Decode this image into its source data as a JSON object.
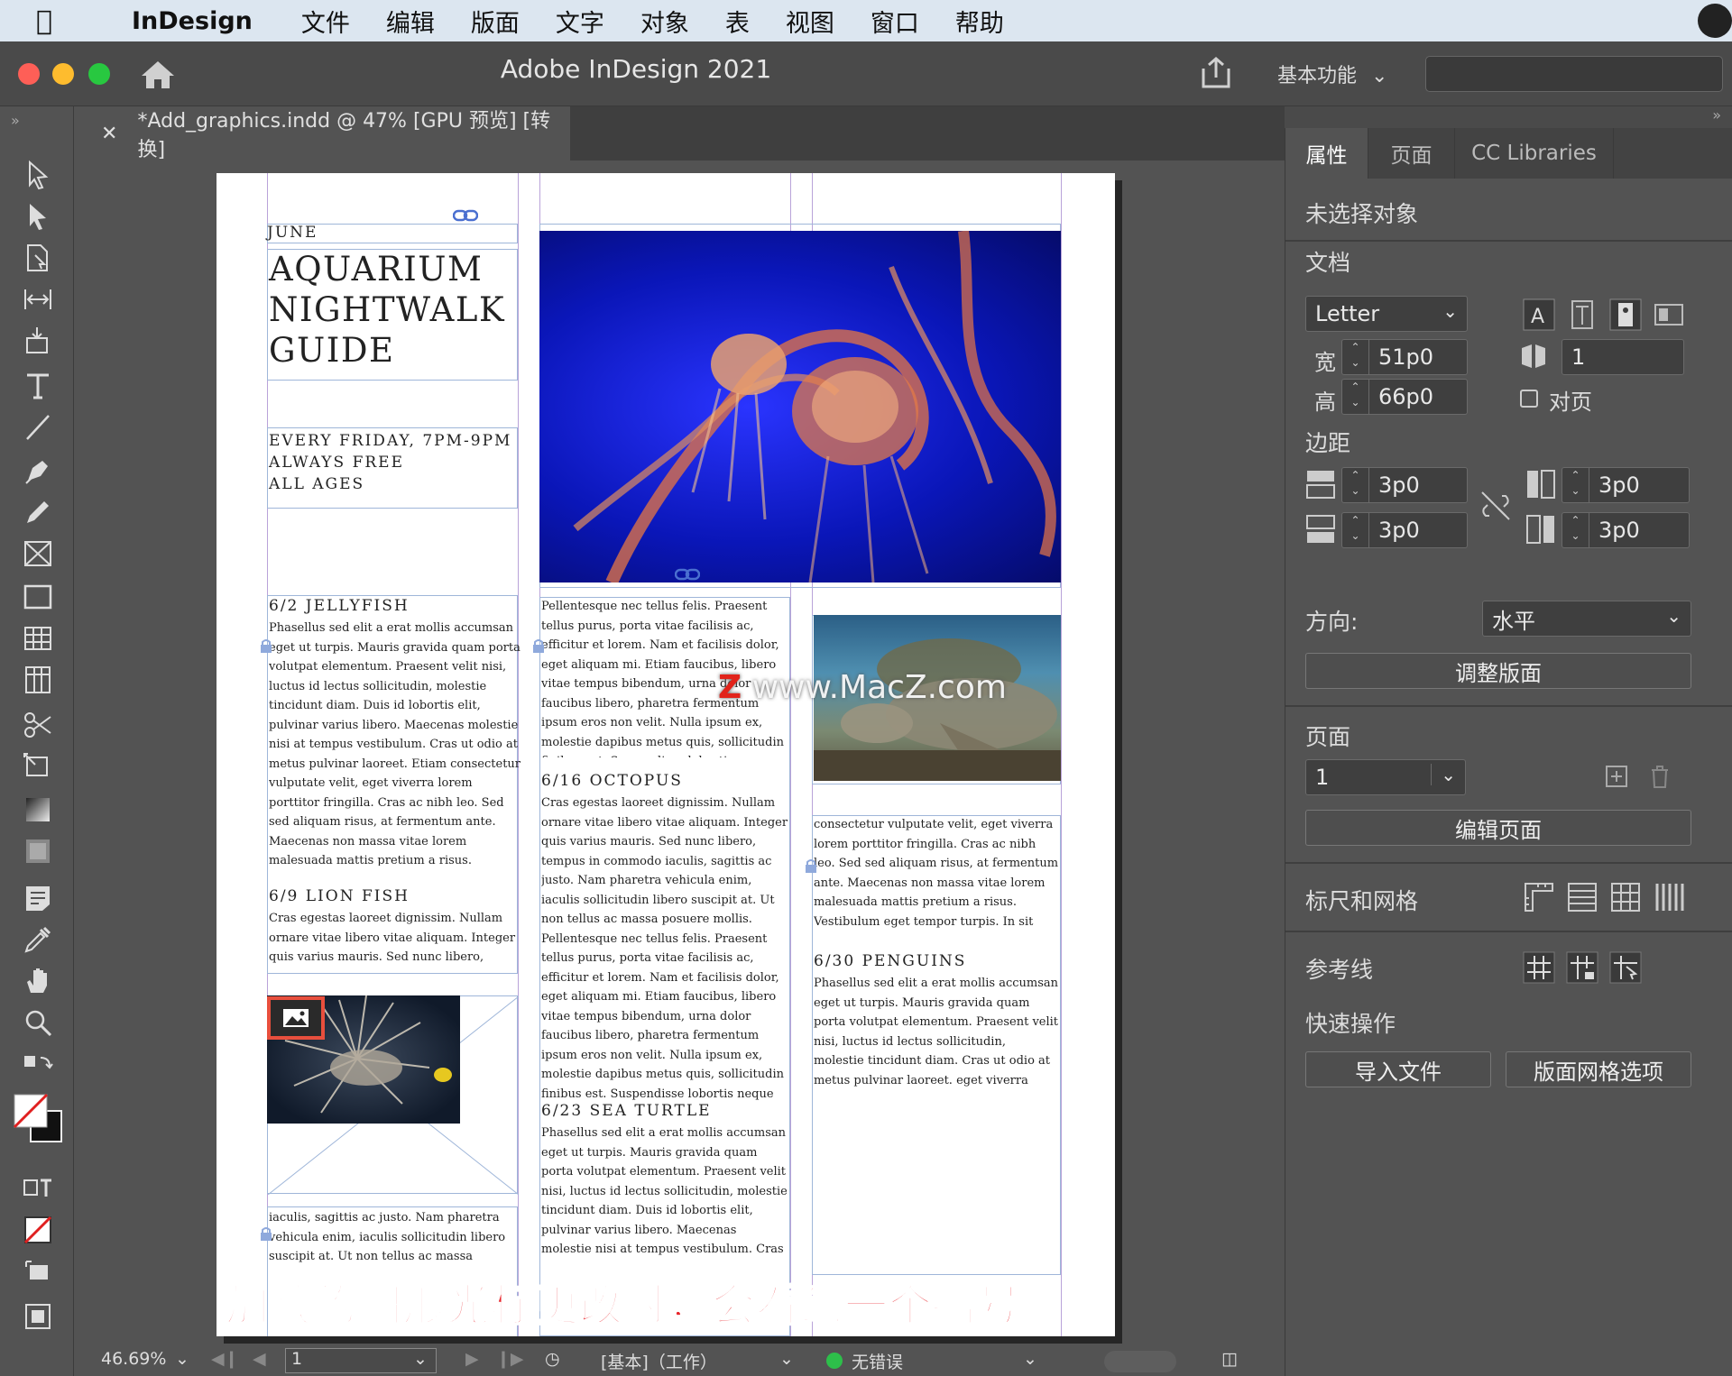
{
  "menubar": {
    "app": "InDesign",
    "items": [
      "文件",
      "编辑",
      "版面",
      "文字",
      "对象",
      "表",
      "视图",
      "窗口",
      "帮助"
    ]
  },
  "window": {
    "title": "Adobe InDesign 2021",
    "workspace": "基本功能"
  },
  "document": {
    "tab_label": "*Add_graphics.indd @ 47% [GPU 预览] [转换]"
  },
  "page": {
    "june": "JUNE",
    "title": "AQUARIUM NIGHTWALK GUIDE",
    "subtitle": "EVERY FRIDAY, 7PM-9PM\nALWAYS FREE\nALL AGES",
    "col1_head1": "6/2 JELLYFISH",
    "col1_body1": "Phasellus sed elit a erat mollis accumsan eget ut turpis. Mauris gravida quam porta volutpat elementum. Praesent velit nisi, luctus id lectus sollicitudin, molestie tincidunt diam. Duis id lobortis elit, pulvinar varius libero. Maecenas molestie nisi at tempus vestibulum. Cras ut odio at metus pulvinar laoreet. Etiam consectetur vulputate velit, eget viverra lorem porttitor fringilla. Cras ac nibh leo. Sed sed aliquam risus, at fermentum ante. Maecenas non massa vitae lorem malesuada mattis pretium a risus. Vestibulum eget tempor turpis. In sit amet facilisis velit.",
    "col1_head2": "6/9 LION FISH",
    "col1_body2": "Cras egestas laoreet dignissim. Nullam ornare vitae libero vitae aliquam. Integer quis varius mauris. Sed nunc libero, tempus in commodo",
    "col1_body3": "iaculis, sagittis ac justo. Nam pharetra vehicula enim, iaculis sollicitudin libero suscipit at. Ut non tellus ac massa posuere mollis.",
    "col2_body1": "Pellentesque nec tellus felis. Praesent tellus purus, porta vitae facilisis ac, efficitur et lorem. Nam et facilisis dolor, eget aliquam mi. Etiam faucibus, libero vitae tempus bibendum, urna dolor faucibus libero, pharetra fermentum ipsum eros non velit. Nulla ipsum ex, molestie dapibus metus quis, sollicitudin finibus est. Suspendisse lobortis neque eget sapien rhoncus, non imperdiet orci ultricies.",
    "col2_head1": "6/16 OCTOPUS",
    "col2_body2": "Cras egestas laoreet dignissim. Nullam ornare vitae libero vitae aliquam. Integer quis varius mauris. Sed nunc libero, tempus in commodo iaculis, sagittis ac justo. Nam pharetra vehicula enim, iaculis sollicitudin libero suscipit at. Ut non tellus ac massa posuere mollis. Pellentesque nec tellus felis. Praesent tellus purus, porta vitae facilisis ac, efficitur et lorem. Nam et facilisis dolor, eget aliquam mi. Etiam faucibus, libero vitae tempus bibendum, urna dolor faucibus libero, pharetra fermentum ipsum eros non velit. Nulla ipsum ex, molestie dapibus metus quis, sollicitudin finibus est. Suspendisse lobortis neque eget sapien rhoncus, non imperdiet orci ultricies.",
    "col2_head2": "6/23 SEA TURTLE",
    "col2_body3": "Phasellus sed elit a erat mollis accumsan eget ut turpis. Mauris gravida quam porta volutpat elementum. Praesent velit nisi, luctus id lectus sollicitudin, molestie tincidunt diam. Duis id lobortis elit, pulvinar varius libero. Maecenas molestie nisi at tempus vestibulum. Cras ut odio at metus pulvinar laoreet. Etiam",
    "col3_body1": "consectetur vulputate velit, eget viverra lorem porttitor fringilla. Cras ac nibh leo. Sed sed aliquam risus, at fermentum ante. Maecenas non massa vitae lorem malesuada mattis pretium a risus. Vestibulum eget tempor turpis. In sit amet facilisis velit.",
    "col3_head1": "6/30 PENGUINS",
    "col3_body2": "Phasellus sed elit a erat mollis accumsan eget ut turpis. Mauris gravida quam porta volutpat elementum. Praesent velit nisi, luctus id lectus sollicitudin, molestie tincidunt diam. Cras ut odio at metus pulvinar laoreet. eget viverra lorem porttitor fringilla. fermentum ante.",
    "watermark_z": "Z",
    "watermark_text": "www.MacZ.com"
  },
  "caption": "加载的图形光标更改时，会看到一个括号",
  "status": {
    "zoom": "46.69%",
    "page": "1",
    "preflight_profile": "[基本]（工作）",
    "errors": "无错误",
    "colors": {
      "ok": "#2dbf4a"
    }
  },
  "properties": {
    "tabs": [
      "属性",
      "页面",
      "CC Libraries"
    ],
    "no_selection": "未选择对象",
    "document_label": "文档",
    "preset": "Letter",
    "width_label": "宽",
    "width": "51p0",
    "height_label": "高",
    "height": "66p0",
    "pages_count": "1",
    "facing_pages": "对页",
    "margins_label": "边距",
    "margin_top": "3p0",
    "margin_bottom": "3p0",
    "margin_left": "3p0",
    "margin_right": "3p0",
    "orientation_label": "方向:",
    "orientation": "水平",
    "adjust_layout": "调整版面",
    "page_label": "页面",
    "page_value": "1",
    "edit_page": "编辑页面",
    "rulers_grids": "标尺和网格",
    "guides": "参考线",
    "quick_actions": "快速操作",
    "import_file": "导入文件",
    "layout_grid_options": "版面网格选项"
  }
}
